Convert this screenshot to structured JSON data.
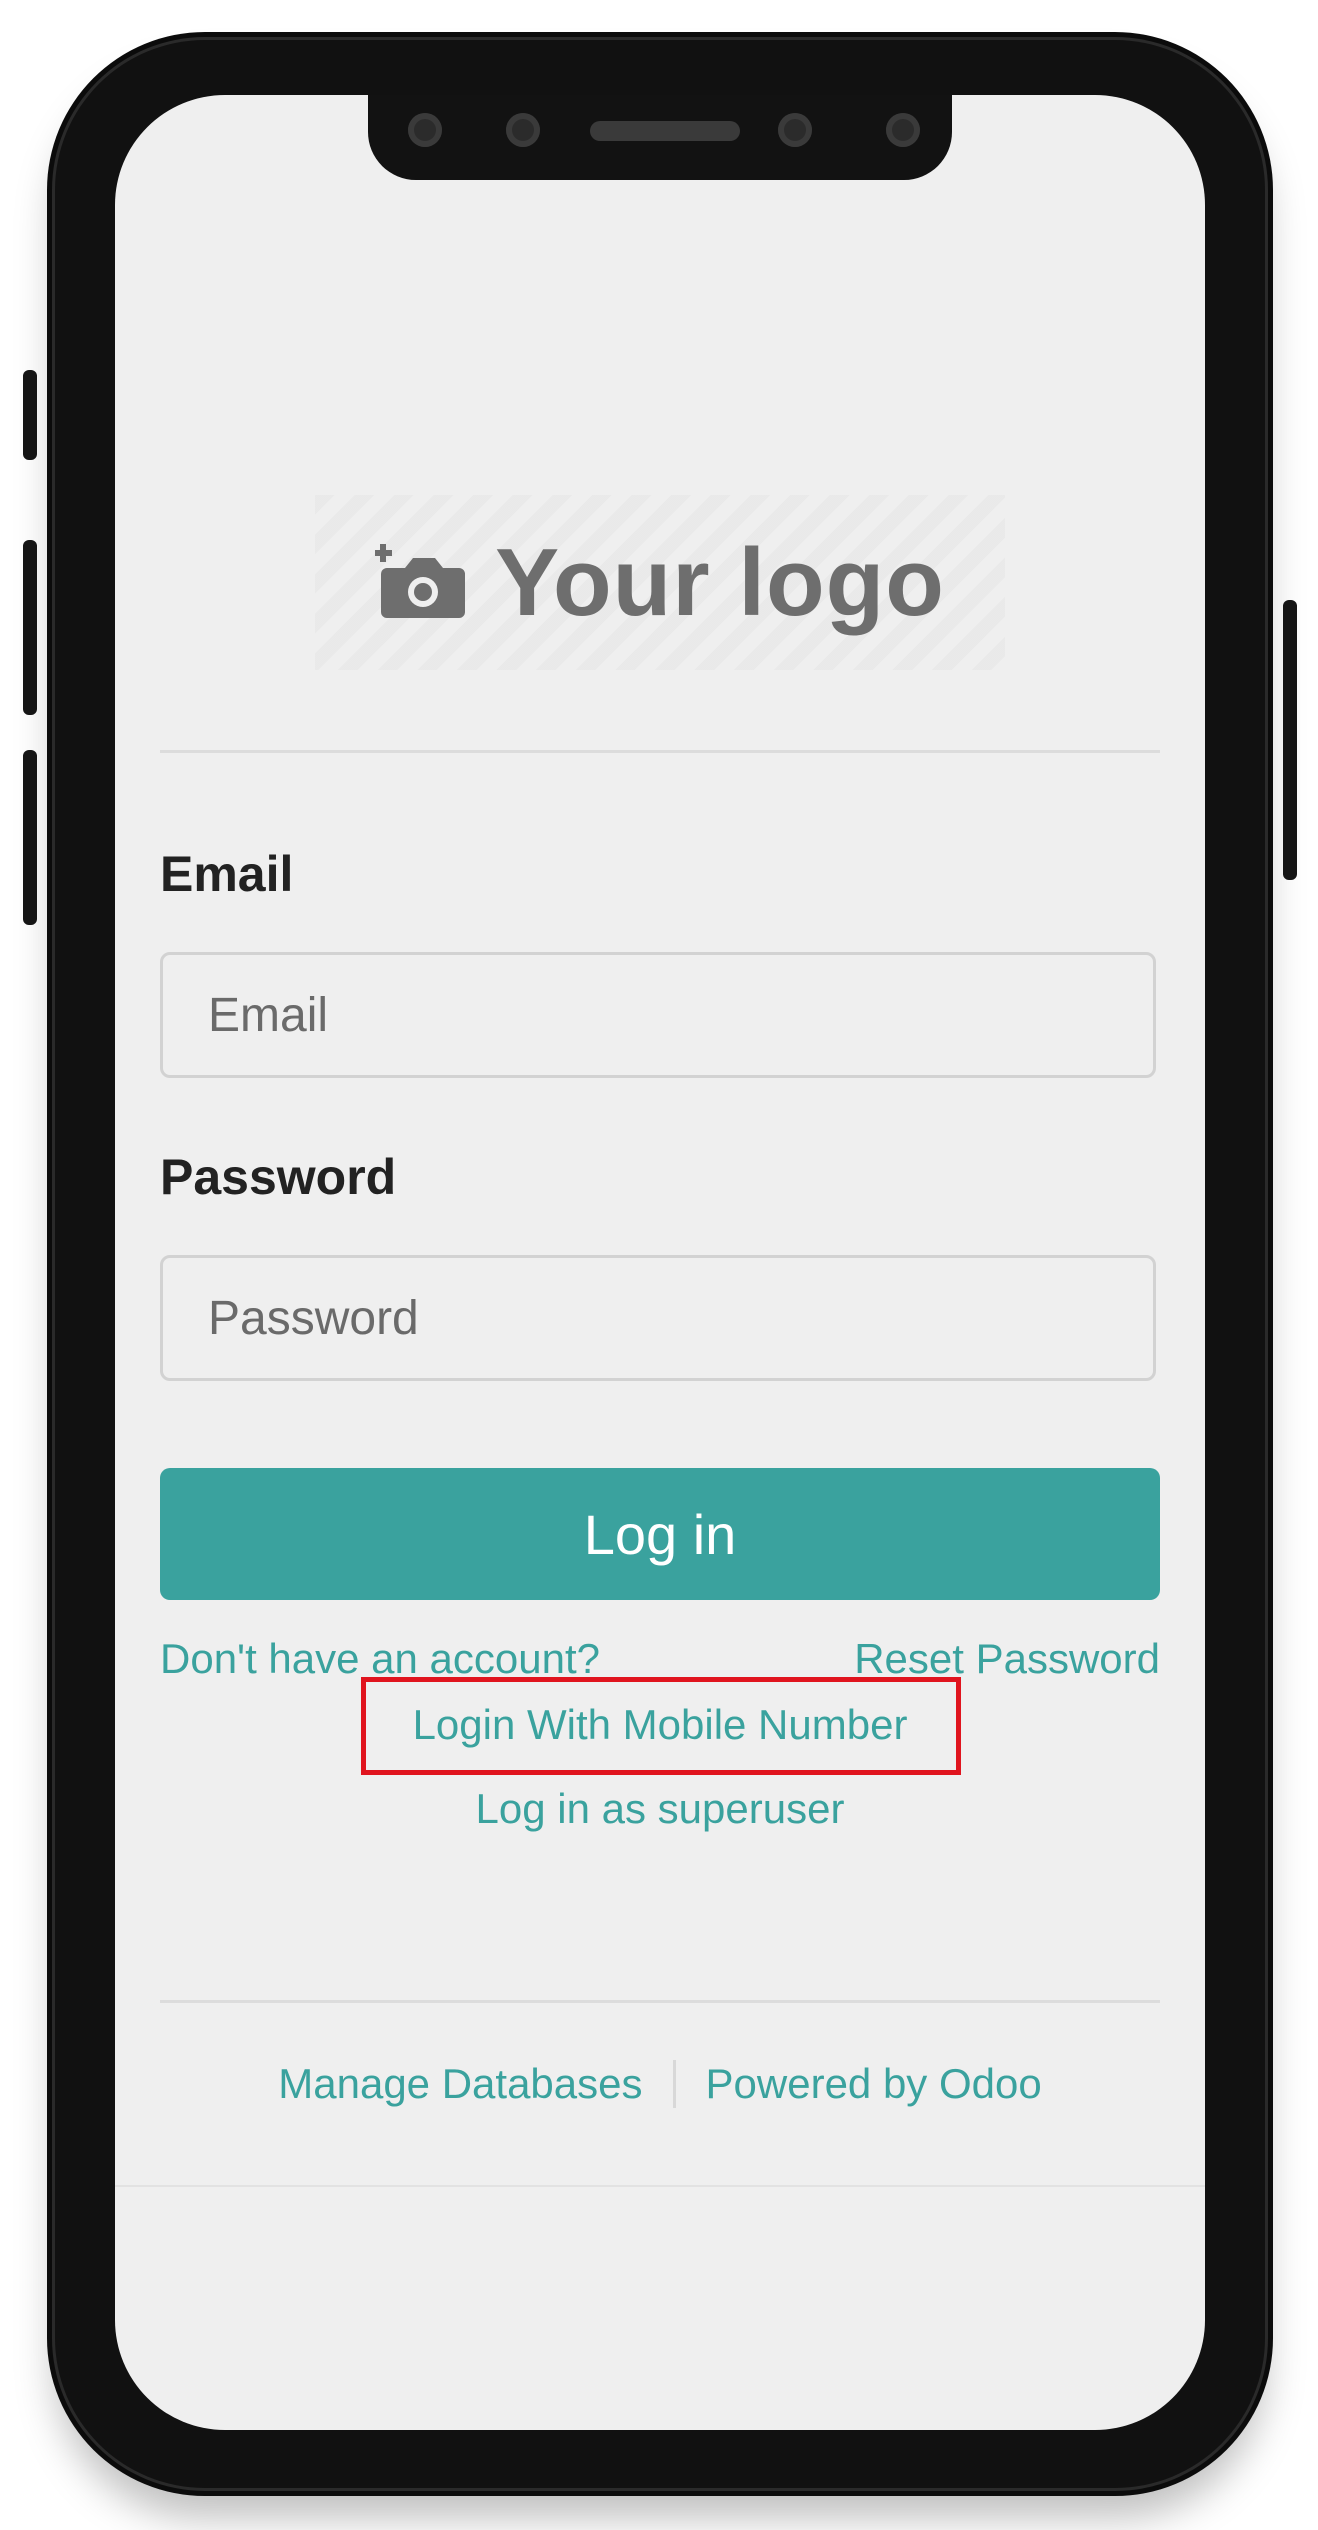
{
  "logo": {
    "text": "Your logo",
    "icon": "camera-plus-icon"
  },
  "form": {
    "email_label": "Email",
    "email_placeholder": "Email",
    "password_label": "Password",
    "password_placeholder": "Password",
    "login_button": "Log in"
  },
  "links": {
    "signup": "Don't have an account?",
    "reset": "Reset Password",
    "mobile_login": "Login With Mobile Number",
    "superuser": "Log in as superuser"
  },
  "footer": {
    "manage_databases": "Manage Databases",
    "powered_by": "Powered by Odoo"
  },
  "colors": {
    "accent": "#3aa29e",
    "highlight": "#e0141e",
    "screen_bg": "#efefef"
  }
}
